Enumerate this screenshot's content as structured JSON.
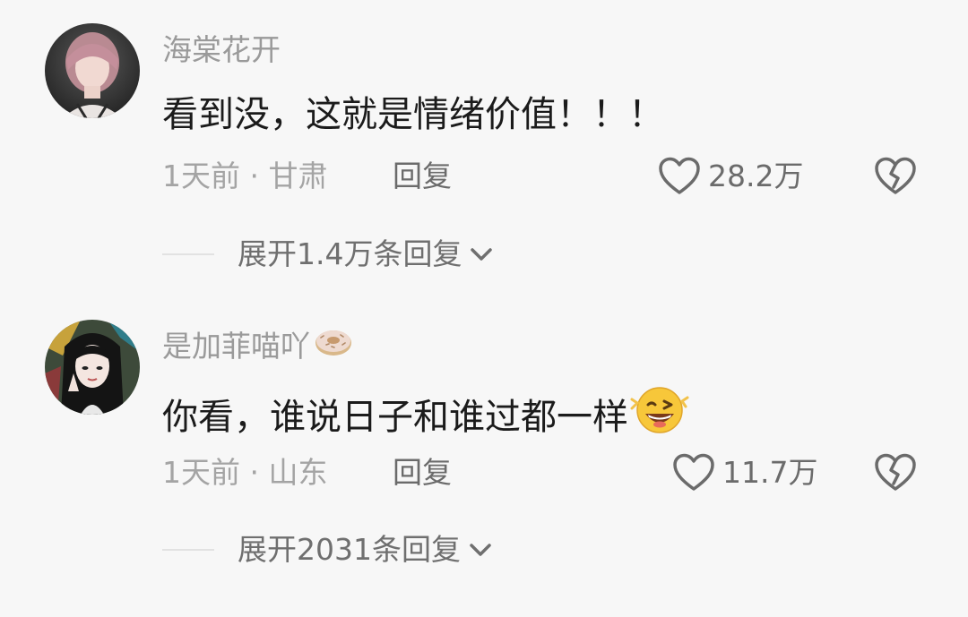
{
  "comments": [
    {
      "username": "海棠花开",
      "text": "看到没，这就是情绪价值！！！",
      "time_location": "1天前 · 甘肃",
      "reply_label": "回复",
      "likes": "28.2万",
      "expand_label": "展开1.4万条回复",
      "avatar_icon": "avatar-photo"
    },
    {
      "username": "是加菲喵吖",
      "username_badge_icon": "donut-icon",
      "text": "你看，谁说日子和谁过都一样",
      "text_emoji_icon": "winking-face-emoji",
      "time_location": "1天前 · 山东",
      "reply_label": "回复",
      "likes": "11.7万",
      "expand_label": "展开2031条回复",
      "avatar_icon": "avatar-illustration"
    }
  ],
  "colors": {
    "background": "#f7f7f7",
    "username": "#9a9a9a",
    "text": "#1b1b1b",
    "meta": "#a4a4a4",
    "action": "#6b6b6b"
  }
}
